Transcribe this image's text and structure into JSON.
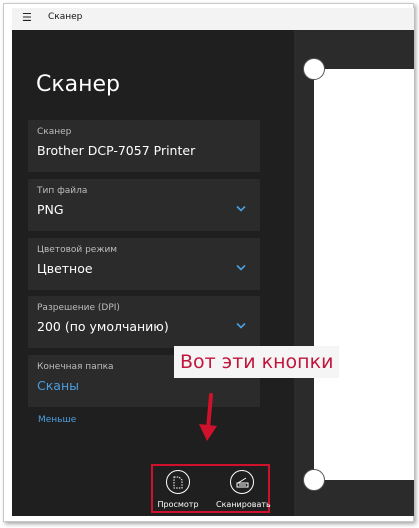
{
  "window": {
    "title": "Сканер",
    "menu_icon": "hamburger-icon"
  },
  "page": {
    "heading": "Сканер"
  },
  "fields": [
    {
      "label": "Сканер",
      "value": "Brother DCP-7057 Printer",
      "dropdown": false
    },
    {
      "label": "Тип файла",
      "value": "PNG",
      "dropdown": true
    },
    {
      "label": "Цветовой режим",
      "value": "Цветное",
      "dropdown": true
    },
    {
      "label": "Разрешение (DPI)",
      "value": "200 (по умолчанию)",
      "dropdown": true
    },
    {
      "label": "Конечная папка",
      "value": "Сканы",
      "dropdown": false,
      "is_link": true
    }
  ],
  "less_link": "Меньше",
  "annotation": {
    "text": "Вот эти кнопки",
    "color": "#c0163c"
  },
  "commands": {
    "preview_label": "Просмотр",
    "preview_icon": "document-preview-icon",
    "scan_label": "Сканировать",
    "scan_icon": "scanner-icon"
  },
  "colors": {
    "accent": "#4a9fe0",
    "pane_background": "#1f1f1f",
    "card_background": "#2b2b2b",
    "highlight": "#d0112b"
  }
}
